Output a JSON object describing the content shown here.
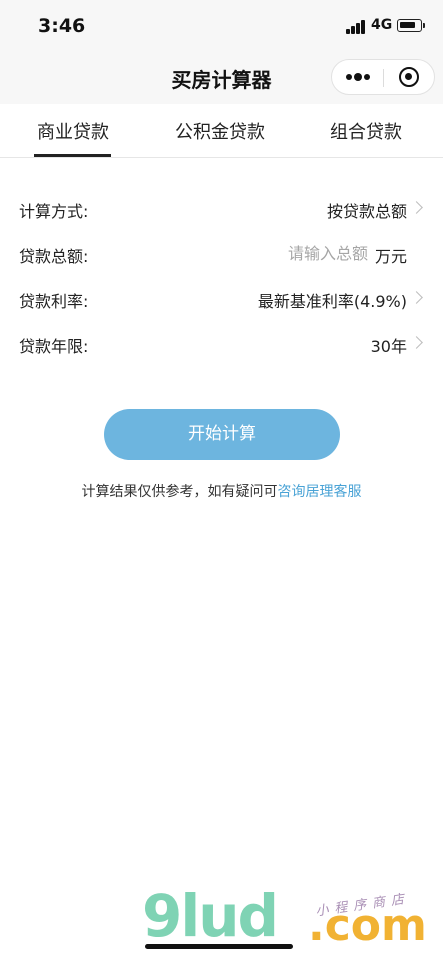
{
  "status_bar": {
    "time": "3:46",
    "network": "4G"
  },
  "nav": {
    "title": "买房计算器"
  },
  "tabs": [
    {
      "label": "商业贷款",
      "active": true
    },
    {
      "label": "公积金贷款",
      "active": false
    },
    {
      "label": "组合贷款",
      "active": false
    }
  ],
  "form": {
    "method": {
      "label": "计算方式:",
      "value": "按贷款总额"
    },
    "amount": {
      "label": "贷款总额:",
      "placeholder": "请输入总额",
      "value": "",
      "unit": "万元"
    },
    "rate": {
      "label": "贷款利率:",
      "value": "最新基准利率(4.9%)"
    },
    "term": {
      "label": "贷款年限:",
      "value": "30年"
    }
  },
  "actions": {
    "calculate_label": "开始计算"
  },
  "note": {
    "text": "计算结果仅供参考，如有疑问可",
    "link": "咨询居理客服"
  },
  "watermark": {
    "logo": "9lud",
    "domain": ".com",
    "tagline": "小程序商店"
  },
  "colors": {
    "accent_button": "#6db5df",
    "link": "#4aa3d6",
    "active_tab": "#222222"
  }
}
